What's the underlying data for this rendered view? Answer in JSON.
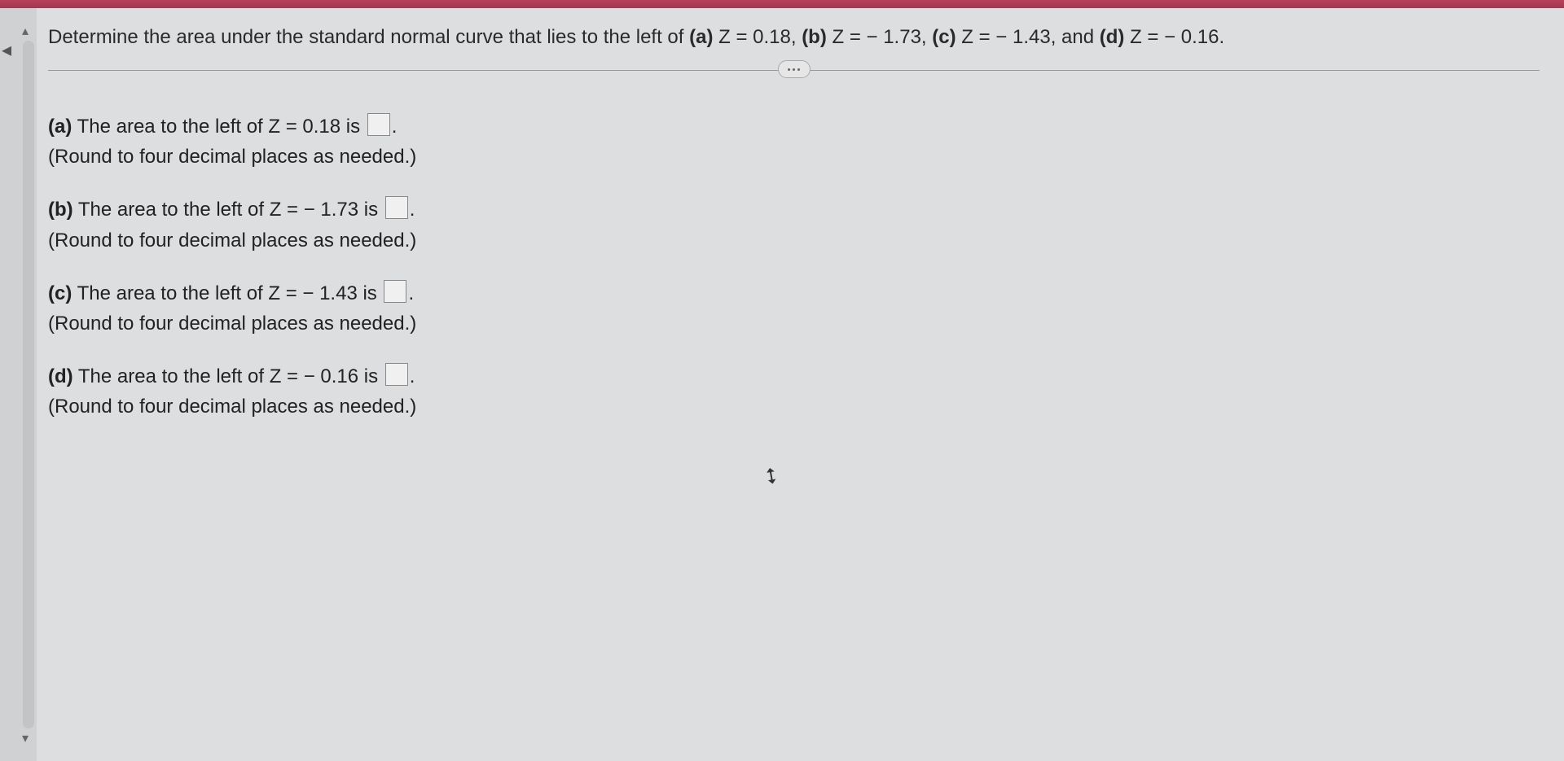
{
  "question": {
    "intro": "Determine the area under the standard normal curve that lies to the left of ",
    "a_label": "(a)",
    "a_expr": "Z = 0.18, ",
    "b_label": "(b)",
    "b_expr": "Z = − 1.73, ",
    "c_label": "(c)",
    "c_expr": "Z = − 1.43, and ",
    "d_label": "(d)",
    "d_expr": "Z = − 0.16."
  },
  "parts": {
    "a": {
      "label": "(a)",
      "text_before": " The area to the left of Z = 0.18 is ",
      "period": ".",
      "hint": "(Round to four decimal places as needed.)"
    },
    "b": {
      "label": "(b)",
      "text_before": " The area to the left of Z = − 1.73 is ",
      "period": ".",
      "hint": "(Round to four decimal places as needed.)"
    },
    "c": {
      "label": "(c)",
      "text_before": " The area to the left of Z = − 1.43 is ",
      "period": ".",
      "hint": "(Round to four decimal places as needed.)"
    },
    "d": {
      "label": "(d)",
      "text_before": " The area to the left of Z = − 0.16 is ",
      "period": ".",
      "hint": "(Round to four decimal places as needed.)"
    }
  }
}
